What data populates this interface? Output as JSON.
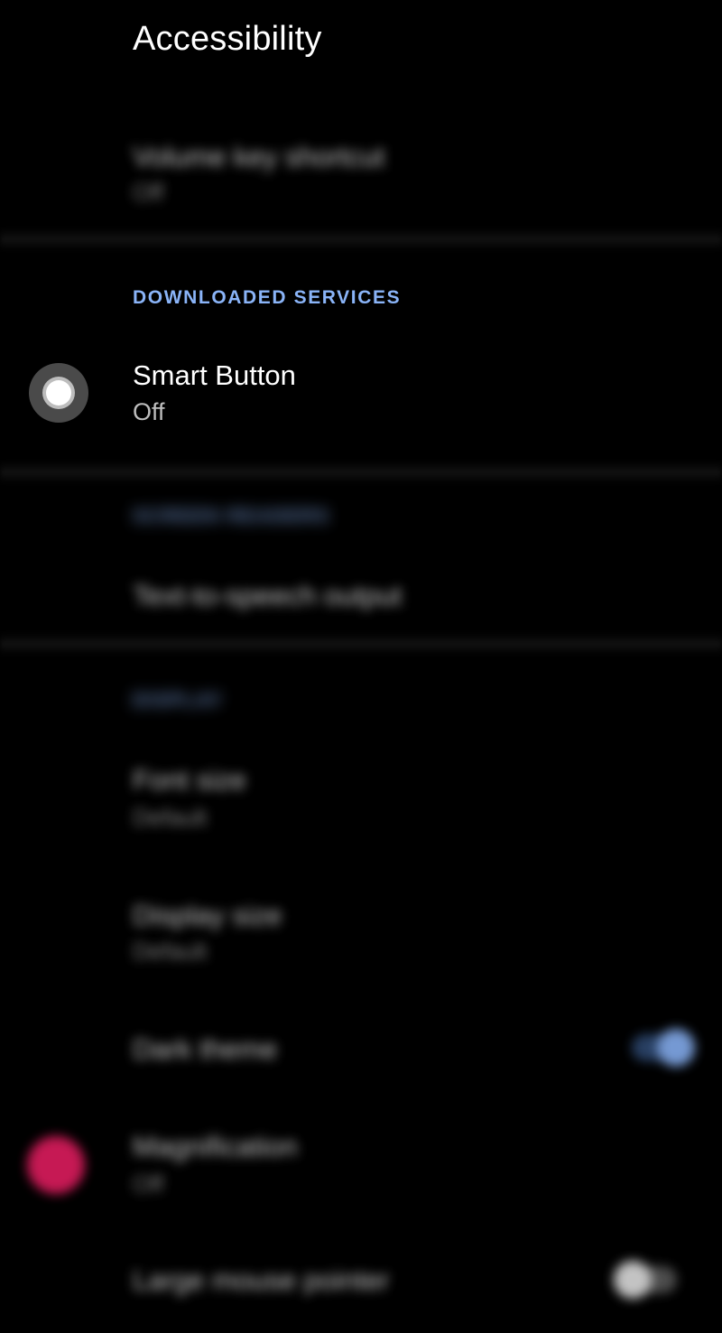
{
  "header": {
    "title": "Accessibility"
  },
  "rows": {
    "volume_key_shortcut": {
      "title": "Volume key shortcut",
      "subtitle": "Off"
    },
    "smart_button": {
      "title": "Smart Button",
      "subtitle": "Off"
    },
    "text_to_speech": {
      "title": "Text-to-speech output"
    },
    "font_size": {
      "title": "Font size",
      "subtitle": "Default"
    },
    "display_size": {
      "title": "Display size",
      "subtitle": "Default"
    },
    "dark_theme": {
      "title": "Dark theme",
      "toggle_on": true
    },
    "magnification": {
      "title": "Magnification",
      "subtitle": "Off"
    },
    "large_mouse_pointer": {
      "title": "Large mouse pointer",
      "toggle_on": false
    }
  },
  "sections": {
    "downloaded_services": "DOWNLOADED SERVICES",
    "screen_readers": "SCREEN READERS",
    "display": "DISPLAY"
  },
  "icons": {
    "smart_button": "smart-button-icon",
    "magnification": "magnification-icon"
  },
  "colors": {
    "background": "#000000",
    "accent": "#8ab4f8",
    "magnification_icon": "#e91e63"
  }
}
